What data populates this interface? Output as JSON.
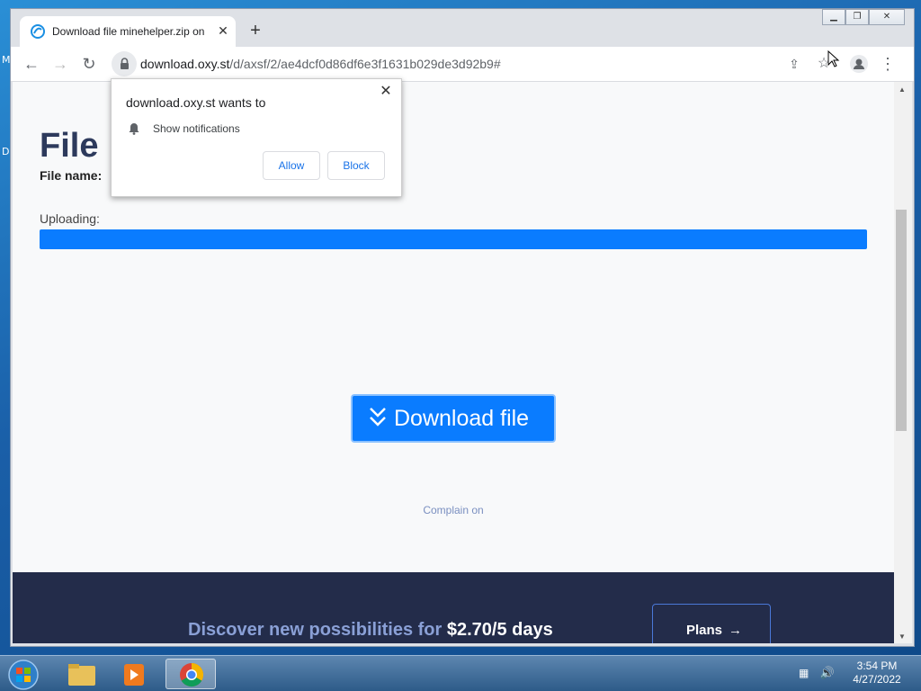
{
  "desktop": {
    "left_letters": [
      "M",
      "D"
    ]
  },
  "browser": {
    "tab_title": "Download file minehelper.zip on",
    "url_host": "download.oxy.st",
    "url_path": "/d/axsf/2/ae4dcf0d86df6e3f1631b029de3d92b9#"
  },
  "page": {
    "heading": "File",
    "file_name_label": "File name:",
    "uploading_label": "Uploading:",
    "progress_percent": 100,
    "download_button": "Download file",
    "complain": "Complain on",
    "footer": {
      "text": "Discover new possibilities for",
      "price": "$2.70/5 days",
      "plans_button": "Plans",
      "plans_arrow": "→"
    }
  },
  "popup": {
    "title": "download.oxy.st wants to",
    "permission": "Show notifications",
    "allow": "Allow",
    "block": "Block"
  },
  "taskbar": {
    "time": "3:54 PM",
    "date": "4/27/2022"
  },
  "colors": {
    "accent": "#0a7cff",
    "footer_bg": "#232c4a"
  }
}
